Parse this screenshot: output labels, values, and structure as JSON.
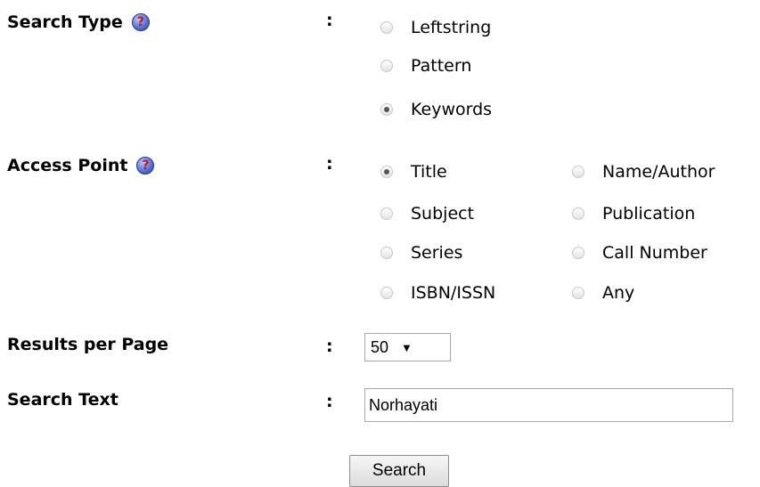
{
  "search_type": {
    "label": "Search Type",
    "help_glyph": "?",
    "colon": ":",
    "options": [
      {
        "label": "Leftstring",
        "checked": false
      },
      {
        "label": "Pattern",
        "checked": false
      },
      {
        "label": "Keywords",
        "checked": true
      }
    ]
  },
  "access_point": {
    "label": "Access Point",
    "help_glyph": "?",
    "colon": ":",
    "options": [
      {
        "label": "Title",
        "checked": true
      },
      {
        "label": "Name/Author",
        "checked": false
      },
      {
        "label": "Subject",
        "checked": false
      },
      {
        "label": "Publication",
        "checked": false
      },
      {
        "label": "Series",
        "checked": false
      },
      {
        "label": "Call Number",
        "checked": false
      },
      {
        "label": "ISBN/ISSN",
        "checked": false
      },
      {
        "label": "Any",
        "checked": false
      }
    ]
  },
  "results_per_page": {
    "label": "Results per Page",
    "colon": ":",
    "selected": "50",
    "arrow": "▼"
  },
  "search_text": {
    "label": "Search Text",
    "colon": ":",
    "value": "Norhayati"
  },
  "search_button": {
    "label": "Search"
  }
}
